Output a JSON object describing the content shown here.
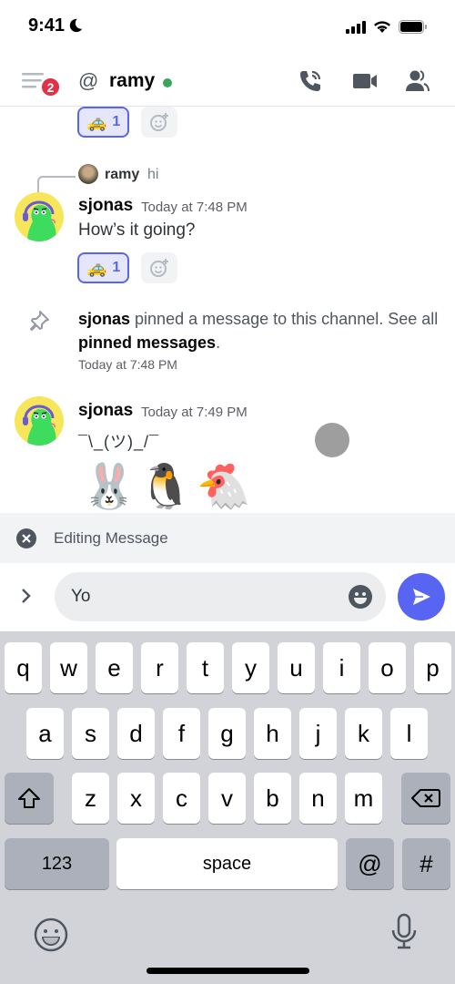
{
  "status_bar": {
    "time": "9:41",
    "icons": [
      "moon-icon",
      "signal-icon",
      "wifi-icon",
      "battery-icon"
    ]
  },
  "header": {
    "menu_badge": "2",
    "channel_prefix": "@",
    "channel_name": "ramy",
    "presence": "online",
    "presence_color": "#3ba55d",
    "actions": [
      "call-icon",
      "video-icon",
      "members-icon"
    ]
  },
  "messages": {
    "top_reaction": {
      "emoji": "🚕",
      "count": "1"
    },
    "reply": {
      "author": "ramy",
      "text": "hi"
    },
    "msg1": {
      "author": "sjonas",
      "time": "Today at 7:48 PM",
      "text": "How’s it going?",
      "reaction": {
        "emoji": "🚕",
        "count": "1"
      }
    },
    "system": {
      "author": "sjonas",
      "text_before": " pinned a message to this channel. See all ",
      "link": "pinned messages",
      "text_after": ".",
      "time": "Today at 7:48 PM"
    },
    "msg2": {
      "author": "sjonas",
      "time": "Today at 7:49 PM",
      "text": "¯\\_(ツ)_/¯",
      "emojis": [
        "🐰",
        "🐧",
        "🐔"
      ]
    }
  },
  "edit_bar": {
    "label": "Editing Message"
  },
  "composer": {
    "value": "Yo",
    "accent": "#5865f2"
  },
  "keyboard": {
    "row1": [
      "q",
      "w",
      "e",
      "r",
      "t",
      "y",
      "u",
      "i",
      "o",
      "p"
    ],
    "row2": [
      "a",
      "s",
      "d",
      "f",
      "g",
      "h",
      "j",
      "k",
      "l"
    ],
    "row3": [
      "z",
      "x",
      "c",
      "v",
      "b",
      "n",
      "m"
    ],
    "numbers_label": "123",
    "space_label": "space",
    "at_label": "@",
    "hash_label": "#"
  }
}
